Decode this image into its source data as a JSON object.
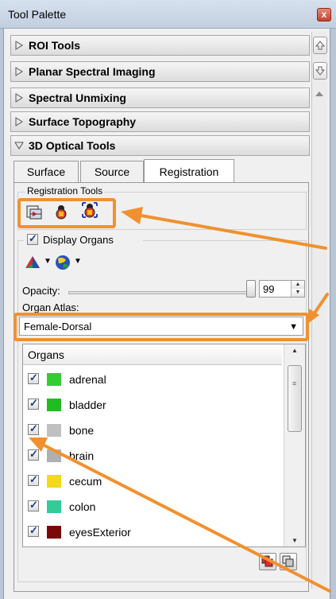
{
  "window": {
    "title": "Tool Palette",
    "close_glyph": "x"
  },
  "sections": [
    {
      "label": "ROI Tools",
      "expanded": false
    },
    {
      "label": "Planar Spectral Imaging",
      "expanded": false
    },
    {
      "label": "Spectral Unmixing",
      "expanded": false
    },
    {
      "label": "Surface Topography",
      "expanded": false
    },
    {
      "label": "3D Optical Tools",
      "expanded": true
    }
  ],
  "tabs": [
    {
      "label": "Surface",
      "active": false
    },
    {
      "label": "Source",
      "active": false
    },
    {
      "label": "Registration",
      "active": true
    }
  ],
  "registration_tools": {
    "label": "Registration Tools",
    "icons": [
      "register-image-icon",
      "mouse-organ-icon",
      "organ-fit-icon"
    ]
  },
  "display_organs": {
    "label": "Display Organs",
    "checked": true,
    "render_icons": [
      "cone-shape-icon",
      "sphere-globe-icon"
    ]
  },
  "opacity": {
    "label": "Opacity:",
    "value": "99",
    "fraction": 0.99
  },
  "organ_atlas": {
    "label": "Organ Atlas:",
    "selected": "Female-Dorsal"
  },
  "organs": {
    "header": "Organs",
    "items": [
      {
        "name": "adrenal",
        "checked": true,
        "color": "#33cc33"
      },
      {
        "name": "bladder",
        "checked": true,
        "color": "#22bb22"
      },
      {
        "name": "bone",
        "checked": true,
        "color": "#c0c0c0"
      },
      {
        "name": "brain",
        "checked": true,
        "color": "#b0b0b0"
      },
      {
        "name": "cecum",
        "checked": true,
        "color": "#f2d91a"
      },
      {
        "name": "colon",
        "checked": true,
        "color": "#33cc99"
      },
      {
        "name": "eyesExterior",
        "checked": true,
        "color": "#7a0a0a"
      }
    ]
  },
  "colors": {
    "callout": "#f0912f",
    "accent": "#1b3d8b"
  }
}
